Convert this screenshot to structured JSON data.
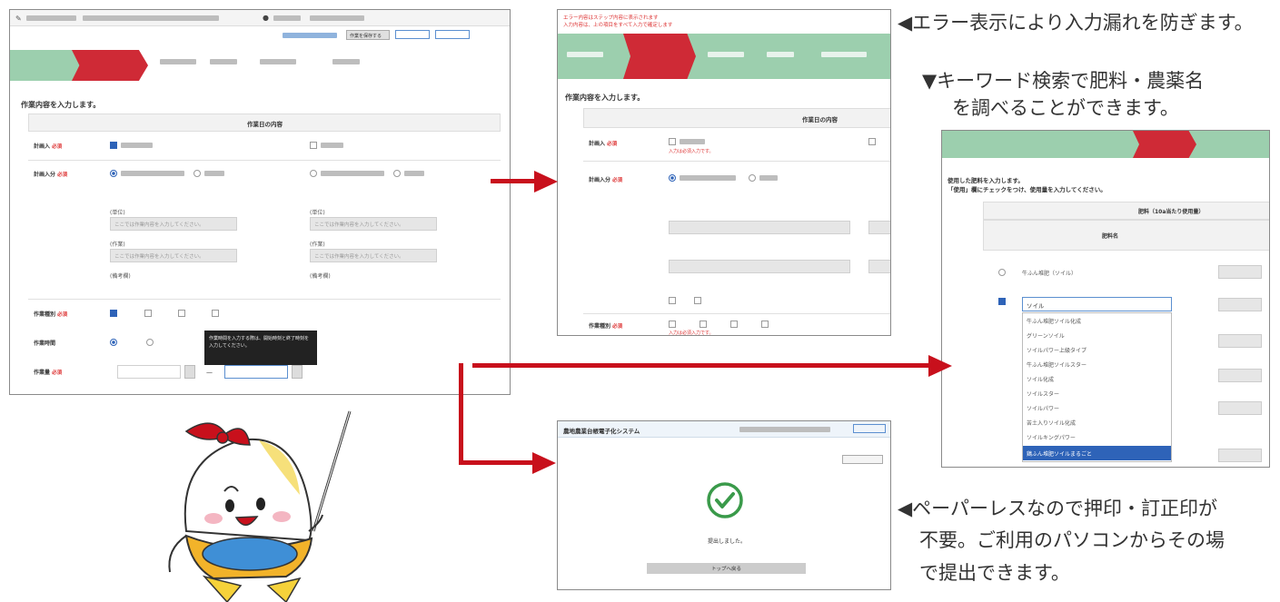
{
  "notes": {
    "error_display": "◀エラー表示により入力漏れを防ぎます。",
    "keyword_line1": "▼キーワード検索で肥料・農薬名",
    "keyword_line2": "を調べることができます。",
    "paperless_line1": "◀ペーパーレスなので押印・訂正印が",
    "paperless_line2": "不要。ご利用のパソコンからその場",
    "paperless_line3": "で提出できます。"
  },
  "main_form": {
    "title": "作業内容を入力します。",
    "section_header": "作業日の内容",
    "header_btn": "作業を保存する",
    "rows": [
      {
        "label": "計画入",
        "required": "必須"
      },
      {
        "label": "計画入分",
        "required": "必須"
      },
      {
        "label": "作業種別",
        "required": "必須"
      },
      {
        "label": "作業時間",
        "required": ""
      },
      {
        "label": "作業量",
        "required": "必須"
      }
    ],
    "field_placeholder": "ここでは作業内容を入力してください。",
    "field_labels": [
      "(単位)",
      "(作業)",
      "(備考欄)"
    ],
    "tooltip": "作業時間を入力する際は、開始時刻と終了時刻を入力してください。"
  },
  "error_form": {
    "error_message_line1": "エラー内容はステップ内容に表示されます",
    "error_message_line2": "入力内容は、上の項目をすべて入力で確定します",
    "title": "作業内容を入力します。",
    "section_header": "作業日の内容",
    "rows": [
      {
        "label": "計画入",
        "required": "必須",
        "error": "入力は必須入力です。"
      },
      {
        "label": "計画入分",
        "required": "必須"
      },
      {
        "label": "作業種別",
        "required": "必須",
        "error": "入力は必須入力です。"
      }
    ]
  },
  "search_form": {
    "intro_line1": "使用した肥料を入力します。",
    "intro_line2": "「使用」欄にチェックをつけ、使用量を入力してください。",
    "col_header": "肥料（10a当たり使用量）",
    "name_col": "肥料名",
    "input_value": "ソイル",
    "first_row": "牛ふん堆肥（ソイル）",
    "suggestions": [
      "牛ふん堆肥ソイル化成",
      "グリーンソイル",
      "ソイルパワー上級タイプ",
      "牛ふん堆肥ソイルスター",
      "ソイル化成",
      "ソイルスター",
      "ソイルパワー",
      "苦土入りソイル化成",
      "ソイルキングパワー",
      "鶏ふん堆肥ソイルまるごと"
    ]
  },
  "complete_screen": {
    "system_title": "農地農業台帳電子化システム",
    "done_text": "提出しました。",
    "back_button": "トップへ戻る"
  },
  "colors": {
    "arrow": "#c8101c",
    "step_green": "#9ccfae",
    "step_active": "#cf2a36",
    "selected": "#2e63b8"
  }
}
